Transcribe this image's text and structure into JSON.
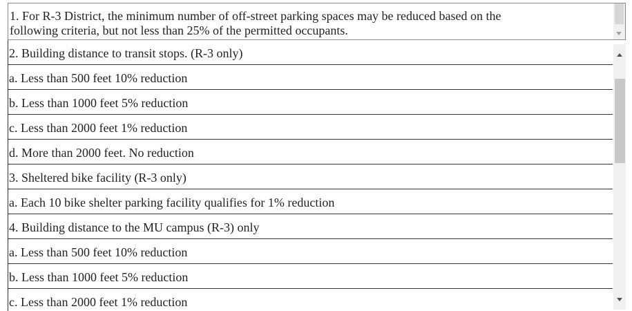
{
  "top_paragraph": {
    "line1": "1. For R-3 District, the minimum number of off-street parking spaces may be reduced based on the",
    "line2": "following criteria, but not less than 25% of the permitted occupants."
  },
  "rows": [
    "2. Building distance to transit stops. (R-3 only)",
    "a. Less than 500 feet 10% reduction",
    "b. Less than 1000 feet 5% reduction",
    "c. Less than 2000 feet 1% reduction",
    "d. More than 2000 feet. No reduction",
    "3. Sheltered bike facility (R-3 only)",
    "a. Each 10 bike shelter parking facility qualifies for 1% reduction",
    "4. Building distance to the MU campus (R-3) only",
    "a. Less than 500 feet 10% reduction",
    "b. Less than 1000 feet 5% reduction",
    "c. Less than 2000 feet 1% reduction"
  ],
  "icons": {
    "scroll_up": "chevron-up-icon",
    "scroll_down": "chevron-down-icon"
  },
  "colors": {
    "text": "#222222",
    "border": "#333333",
    "scroll_track": "#f0f0f0",
    "scroll_thumb": "#c8c8c8"
  }
}
